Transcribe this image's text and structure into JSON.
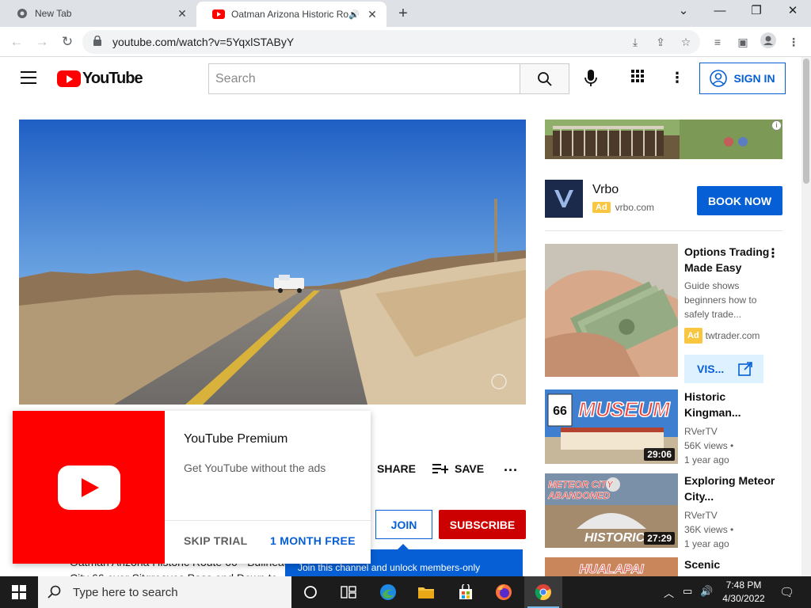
{
  "browser": {
    "tabs": [
      {
        "title": "New Tab",
        "active": false
      },
      {
        "title": "Oatman Arizona Historic Rou",
        "active": true
      }
    ],
    "url": "youtube.com/watch?v=5YqxlSTAByY",
    "icons": [
      "back-icon",
      "forward-icon",
      "reload-icon",
      "lock-icon",
      "install-icon",
      "share-icon",
      "star-icon",
      "media-control-icon",
      "side-panel-icon",
      "profile-icon",
      "menu-icon"
    ]
  },
  "youtube": {
    "logo_text": "YouTube",
    "search_placeholder": "Search",
    "sign_in": "SIGN IN",
    "brand_red": "#ff0000",
    "accent_blue": "#065fd4"
  },
  "actions": {
    "share": "SHARE",
    "save": "SAVE",
    "join": "JOIN",
    "subscribe": "SUBSCRIBE"
  },
  "join_tooltip": "Join this channel and unlock members-only",
  "description_partial": "Oatman Arizona Historic Route 66 - Bullhead City 66 over Sitgreaves Pass and Down to Cool S",
  "premium_promo": {
    "title": "YouTube Premium",
    "subtitle": "Get YouTube without the ads",
    "skip": "SKIP TRIAL",
    "cta": "1 MONTH FREE"
  },
  "ad": {
    "advertiser": "Vrbo",
    "badge": "Ad",
    "domain": "vrbo.com",
    "cta": "BOOK NOW"
  },
  "sidebar": [
    {
      "kind": "ad",
      "title": "Options Trading Made Easy",
      "description": "Guide shows beginners how to safely trade...",
      "badge": "Ad",
      "domain": "twtrader.com",
      "cta": "VIS..."
    },
    {
      "kind": "video",
      "title": "Historic Kingman...",
      "channel": "RVerTV",
      "views": "56K views",
      "age": "1 year ago",
      "duration": "29:06",
      "thumb_text": "MUSEUM"
    },
    {
      "kind": "video",
      "title": "Exploring Meteor City...",
      "channel": "RVerTV",
      "views": "36K views",
      "age": "1 year ago",
      "duration": "27:29",
      "thumb_text": "METEOR CITY ABANDONED"
    },
    {
      "kind": "video",
      "title": "Scenic",
      "thumb_text": "HUALAPAI"
    }
  ],
  "taskbar": {
    "search_placeholder": "Type here to search",
    "time": "7:48 PM",
    "date": "4/30/2022",
    "apps": [
      "cortana-icon",
      "task-view-icon",
      "edge-icon",
      "file-explorer-icon",
      "store-icon",
      "firefox-icon",
      "chrome-icon"
    ]
  }
}
